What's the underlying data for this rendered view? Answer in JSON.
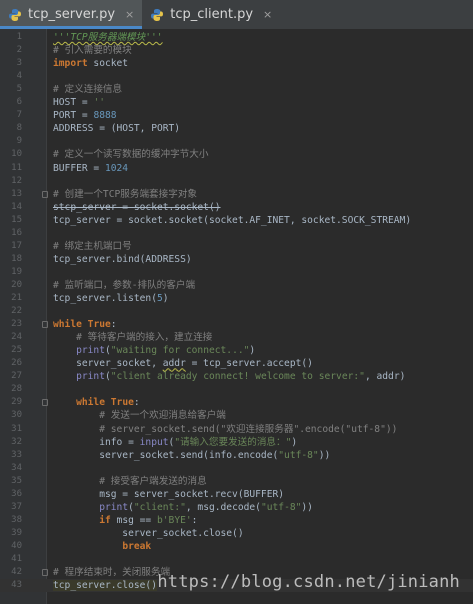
{
  "tabs": [
    {
      "label": "tcp_server.py",
      "active": true,
      "close": "×"
    },
    {
      "label": "tcp_client.py",
      "active": false,
      "close": "×"
    }
  ],
  "code": [
    {
      "n": "1",
      "t": [
        [
          "doc wavy",
          "'''TCP服务器端模块'''"
        ]
      ]
    },
    {
      "n": "2",
      "t": [
        [
          "c",
          "# 引入需要的模块"
        ]
      ]
    },
    {
      "n": "3",
      "t": [
        [
          "k",
          "import"
        ],
        [
          "",
          " socket"
        ]
      ]
    },
    {
      "n": "4",
      "t": []
    },
    {
      "n": "5",
      "t": [
        [
          "c",
          "# 定义连接信息"
        ]
      ]
    },
    {
      "n": "6",
      "t": [
        [
          "",
          "HOST = "
        ],
        [
          "s",
          "''"
        ]
      ]
    },
    {
      "n": "7",
      "t": [
        [
          "",
          "PORT = "
        ],
        [
          "n",
          "8888"
        ]
      ]
    },
    {
      "n": "8",
      "t": [
        [
          "",
          "ADDRESS = (HOST, PORT)"
        ]
      ]
    },
    {
      "n": "9",
      "t": []
    },
    {
      "n": "10",
      "t": [
        [
          "c",
          "# 定义一个读写数据的缓冲字节大小"
        ]
      ]
    },
    {
      "n": "11",
      "t": [
        [
          "",
          "BUFFER = "
        ],
        [
          "n",
          "1024"
        ]
      ]
    },
    {
      "n": "12",
      "t": []
    },
    {
      "n": "13",
      "t": [
        [
          "c",
          "# 创建一个TCP服务端套接字对象"
        ]
      ]
    },
    {
      "n": "14",
      "t": [
        [
          "strike",
          "stcp_server = socket.socket()"
        ]
      ]
    },
    {
      "n": "15",
      "t": [
        [
          "",
          "tcp_server = socket.socket(socket.AF_INET, socket.SOCK_STREAM)"
        ]
      ]
    },
    {
      "n": "16",
      "t": []
    },
    {
      "n": "17",
      "t": [
        [
          "c",
          "# 绑定主机端口号"
        ]
      ]
    },
    {
      "n": "18",
      "t": [
        [
          "",
          "tcp_server.bind(ADDRESS)"
        ]
      ]
    },
    {
      "n": "19",
      "t": []
    },
    {
      "n": "20",
      "t": [
        [
          "c",
          "# 监听端口，参数-排队的客户端"
        ]
      ]
    },
    {
      "n": "21",
      "t": [
        [
          "",
          "tcp_server.listen("
        ],
        [
          "n",
          "5"
        ],
        [
          "",
          ")"
        ]
      ]
    },
    {
      "n": "22",
      "t": []
    },
    {
      "n": "23",
      "t": [
        [
          "k",
          "while"
        ],
        [
          "",
          " "
        ],
        [
          "k",
          "True"
        ],
        [
          "",
          ":"
        ]
      ]
    },
    {
      "n": "24",
      "t": [
        [
          "",
          "    "
        ],
        [
          "c",
          "# 等待客户端的接入，建立连接"
        ]
      ]
    },
    {
      "n": "25",
      "t": [
        [
          "",
          "    "
        ],
        [
          "b",
          "print"
        ],
        [
          "",
          "("
        ],
        [
          "s",
          "\"waiting for connect...\""
        ],
        [
          "",
          ")"
        ]
      ]
    },
    {
      "n": "26",
      "t": [
        [
          "",
          "    server_socket, "
        ],
        [
          "wavy",
          "addr"
        ],
        [
          "",
          " = tcp_server.accept()"
        ]
      ]
    },
    {
      "n": "27",
      "t": [
        [
          "",
          "    "
        ],
        [
          "b",
          "print"
        ],
        [
          "",
          "("
        ],
        [
          "s",
          "\"client already connect! welcome to server:\""
        ],
        [
          "",
          ", addr)"
        ]
      ]
    },
    {
      "n": "28",
      "t": []
    },
    {
      "n": "29",
      "t": [
        [
          "",
          "    "
        ],
        [
          "k",
          "while"
        ],
        [
          "",
          " "
        ],
        [
          "k",
          "True"
        ],
        [
          "",
          ":"
        ]
      ]
    },
    {
      "n": "30",
      "t": [
        [
          "",
          "        "
        ],
        [
          "c",
          "# 发送一个欢迎消息给客户端"
        ]
      ]
    },
    {
      "n": "31",
      "t": [
        [
          "",
          "        "
        ],
        [
          "c",
          "# server_socket.send(\"欢迎连接服务器\".encode(\"utf-8\"))"
        ]
      ]
    },
    {
      "n": "32",
      "t": [
        [
          "",
          "        info = "
        ],
        [
          "b",
          "input"
        ],
        [
          "",
          "("
        ],
        [
          "s",
          "\"请输入您要发送的消息：\""
        ],
        [
          "",
          ")"
        ]
      ]
    },
    {
      "n": "33",
      "t": [
        [
          "",
          "        server_socket.send(info.encode("
        ],
        [
          "s",
          "\"utf-8\""
        ],
        [
          "",
          "))"
        ]
      ]
    },
    {
      "n": "34",
      "t": []
    },
    {
      "n": "35",
      "t": [
        [
          "",
          "        "
        ],
        [
          "c",
          "# 接受客户端发送的消息"
        ]
      ]
    },
    {
      "n": "36",
      "t": [
        [
          "",
          "        msg = server_socket.recv(BUFFER)"
        ]
      ]
    },
    {
      "n": "37",
      "t": [
        [
          "",
          "        "
        ],
        [
          "b",
          "print"
        ],
        [
          "",
          "("
        ],
        [
          "s",
          "\"client:\""
        ],
        [
          "",
          ", msg.decode("
        ],
        [
          "s",
          "\"utf-8\""
        ],
        [
          "",
          "))"
        ]
      ]
    },
    {
      "n": "38",
      "t": [
        [
          "",
          "        "
        ],
        [
          "k",
          "if"
        ],
        [
          "",
          " msg == "
        ],
        [
          "s",
          "b'BYE'"
        ],
        [
          "",
          ":"
        ]
      ]
    },
    {
      "n": "39",
      "t": [
        [
          "",
          "            server_socket.close()"
        ]
      ]
    },
    {
      "n": "40",
      "t": [
        [
          "",
          "            "
        ],
        [
          "k",
          "break"
        ]
      ]
    },
    {
      "n": "41",
      "t": []
    },
    {
      "n": "42",
      "t": [
        [
          "c",
          "# 程序结束时，关闭服务端"
        ]
      ]
    },
    {
      "n": "43",
      "t": [
        [
          "hl",
          "tcp_server.close()"
        ]
      ]
    }
  ],
  "folds": [
    "13",
    "23",
    "29",
    "42"
  ],
  "watermark": "https://blog.csdn.net/jinianh",
  "colors": {
    "background": "#2b2b2b",
    "gutter": "#313335",
    "keyword": "#cc7832",
    "comment": "#808080",
    "string": "#6a8759",
    "number": "#6897bb",
    "builtin": "#8888c6",
    "default": "#a9b7c6"
  }
}
